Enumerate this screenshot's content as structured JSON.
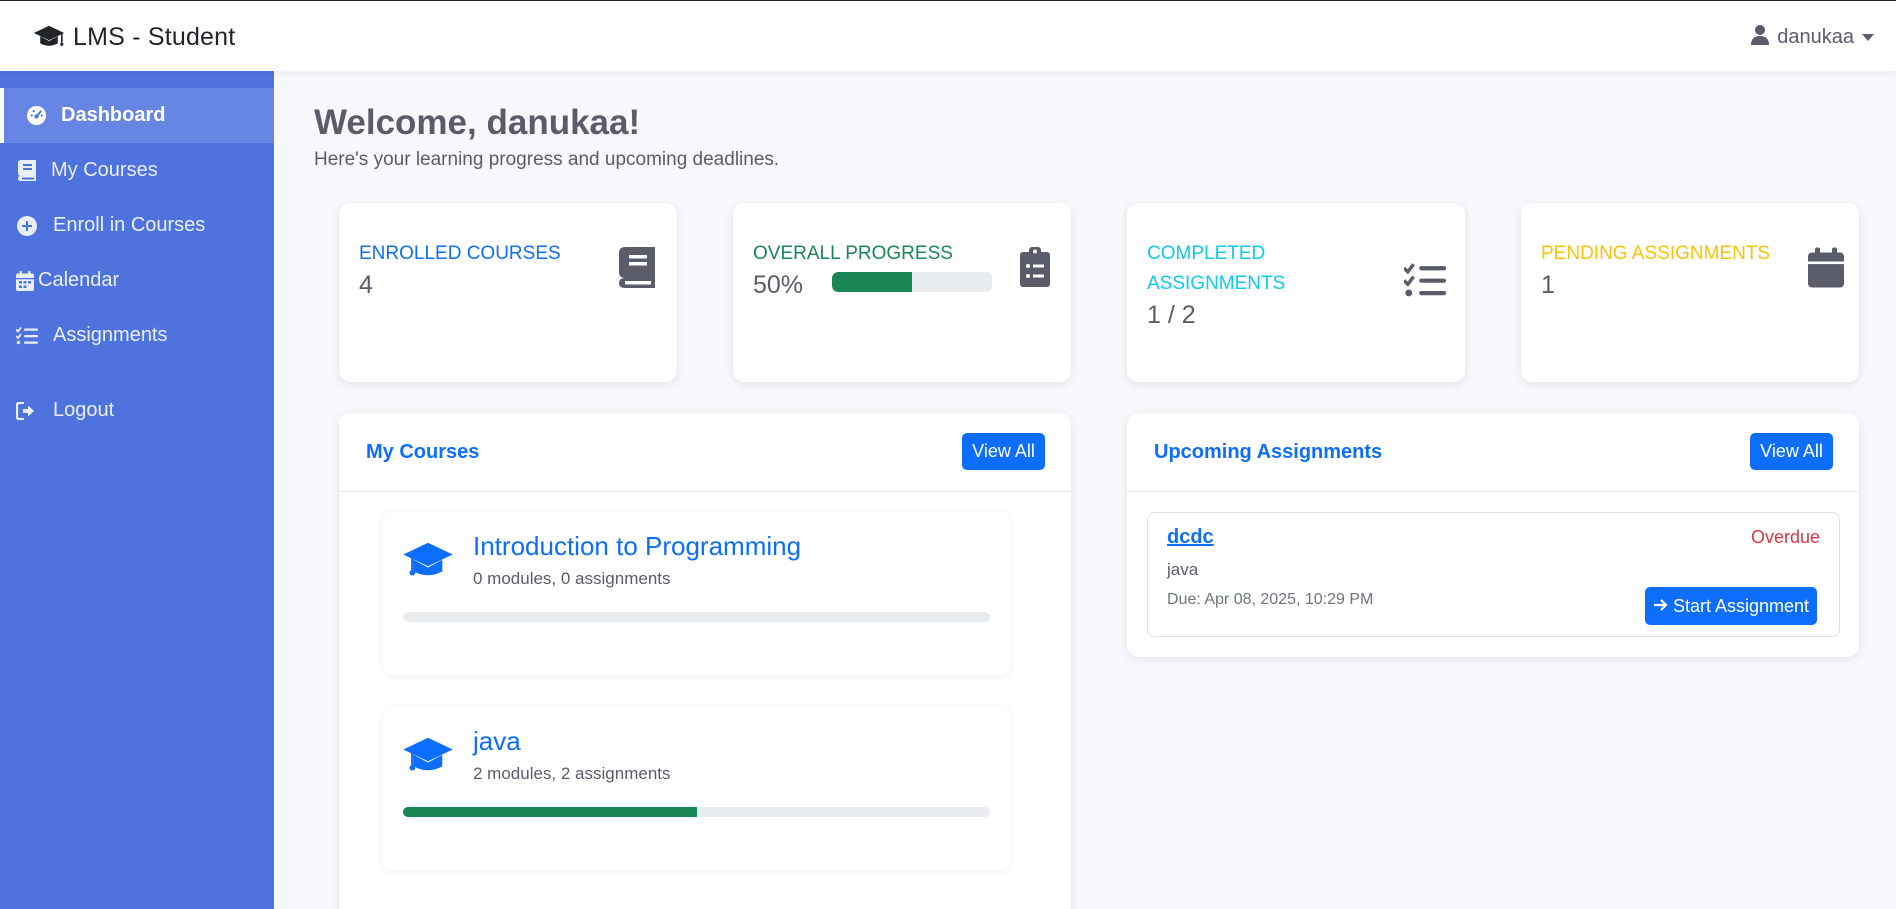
{
  "navbar": {
    "brand_icon": "graduation-cap-icon",
    "brand": "LMS - Student",
    "user_icon": "user-icon",
    "user_name": "danukaa"
  },
  "sidebar": {
    "items": [
      {
        "label": "Dashboard",
        "icon": "dashboard-gauge-icon",
        "active": true
      },
      {
        "label": "My Courses",
        "icon": "book-icon"
      },
      {
        "label": "Enroll in Courses",
        "icon": "plus-circle-icon"
      },
      {
        "label": "Calendar",
        "icon": "calendar-icon"
      },
      {
        "label": "Assignments",
        "icon": "tasks-list-icon"
      },
      {
        "label": "Logout",
        "icon": "sign-out-icon"
      }
    ]
  },
  "welcome": {
    "title": "Welcome, danukaa!",
    "subtitle": "Here's your learning progress and upcoming deadlines."
  },
  "stats": {
    "enrolled": {
      "label": "ENROLLED COURSES",
      "value": "4",
      "icon": "book-icon",
      "color": "#0d6efd"
    },
    "progress": {
      "label": "OVERALL PROGRESS",
      "value": "50%",
      "percent": 50,
      "icon": "clipboard-list-icon",
      "color": "#198754"
    },
    "completed": {
      "label": "COMPLETED ASSIGNMENTS",
      "value": "1 / 2",
      "icon": "tasks-list-icon",
      "color": "#0dcaf0"
    },
    "pending": {
      "label": "PENDING ASSIGNMENTS",
      "value": "1",
      "icon": "calendar-icon",
      "color": "#ffc107"
    }
  },
  "courses_panel": {
    "title": "My Courses",
    "view_all": "View All",
    "courses": [
      {
        "title": "Introduction to Programming",
        "meta": "0 modules, 0 assignments",
        "progress": 0,
        "icon": "graduation-cap-icon"
      },
      {
        "title": "java",
        "meta": "2 modules, 2 assignments",
        "progress": 50,
        "icon": "graduation-cap-icon"
      }
    ]
  },
  "assignments_panel": {
    "title": "Upcoming Assignments",
    "view_all": "View All",
    "items": [
      {
        "name": "dcdc",
        "status": "Overdue",
        "course": "java",
        "due": "Due: Apr 08, 2025, 10:29 PM",
        "action": "Start Assignment",
        "action_icon": "arrow-right-icon"
      }
    ]
  },
  "colors": {
    "sidebar_bg": "#4e73df",
    "primary": "#0d6efd",
    "success": "#198754",
    "info": "#0dcaf0",
    "warning": "#ffc107",
    "danger": "#dc3545",
    "icon_gray": "#5a5c69"
  }
}
